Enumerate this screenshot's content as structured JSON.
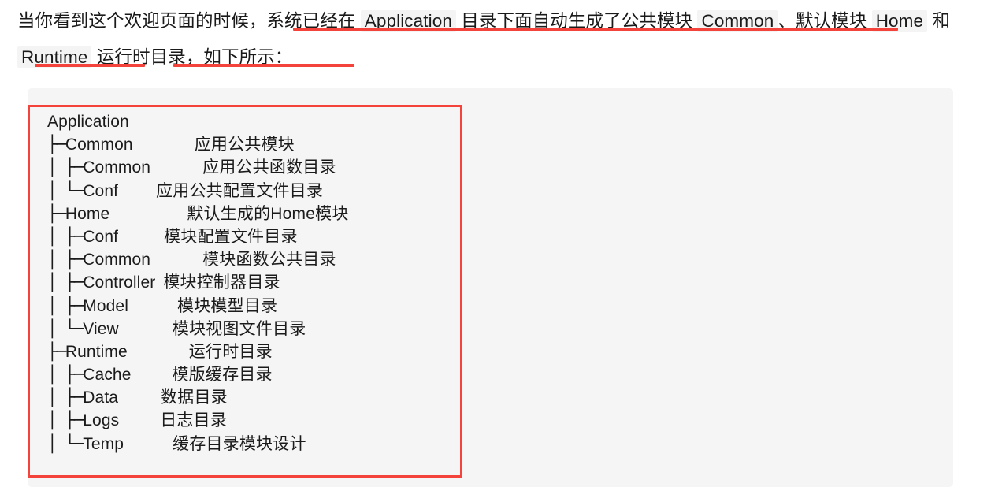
{
  "paragraph": {
    "segments": [
      {
        "type": "text",
        "value": "当你看到这个欢迎页面的时候，"
      },
      {
        "type": "text",
        "value": "系统已经在 "
      },
      {
        "type": "code",
        "value": "Application"
      },
      {
        "type": "text",
        "value": " 目录下面自动生成了公共模块 "
      },
      {
        "type": "code",
        "value": "Common"
      },
      {
        "type": "text",
        "value": "、默认模块 "
      },
      {
        "type": "code",
        "value": "Home"
      },
      {
        "type": "text",
        "value": " 和 "
      },
      {
        "type": "code",
        "value": "Runtime"
      },
      {
        "type": "text",
        "value": " 运行时目录，如下所示："
      }
    ],
    "line1": "当你看到这个欢迎页面的时候，系统已经在 Application 目录下面自动生成了公共模块 Common 、默认",
    "line2": "模块 Home 和 Runtime 运行时目录，如下所示：",
    "marker_color": "#f4433a",
    "code_background": "#f4f4f4",
    "text_color": "#1a1a1a"
  },
  "code_panel": {
    "background": "#f5f5f5",
    "highlight_border_color": "#f4433a"
  },
  "tree": {
    "rows": [
      {
        "branch": "",
        "gap1": 0,
        "name": "Application",
        "gap2": 0,
        "desc": ""
      },
      {
        "branch": "├─",
        "gap1": 0,
        "name": "Common",
        "gap2": 78,
        "desc": "应用公共模块"
      },
      {
        "branch": "│  ├─",
        "gap1": 0,
        "name": "Common",
        "gap2": 66,
        "desc": "应用公共函数目录"
      },
      {
        "branch": "│  └─",
        "gap1": 0,
        "name": "Conf",
        "gap2": 48,
        "desc": "应用公共配置文件目录"
      },
      {
        "branch": "├─",
        "gap1": 0,
        "name": "Home",
        "gap2": 98,
        "desc": "默认生成的Home模块"
      },
      {
        "branch": "│  ├─",
        "gap1": 0,
        "name": "Conf",
        "gap2": 58,
        "desc": "模块配置文件目录"
      },
      {
        "branch": "│  ├─",
        "gap1": 0,
        "name": "Common",
        "gap2": 66,
        "desc": "模块函数公共目录"
      },
      {
        "branch": "│  ├─",
        "gap1": 0,
        "name": "Controller",
        "gap2": 10,
        "desc": "模块控制器目录"
      },
      {
        "branch": "│  ├─",
        "gap1": 0,
        "name": "Model",
        "gap2": 62,
        "desc": "模块模型目录"
      },
      {
        "branch": "│  └─",
        "gap1": 0,
        "name": "View",
        "gap2": 68,
        "desc": "模块视图文件目录"
      },
      {
        "branch": "├─",
        "gap1": 0,
        "name": "Runtime",
        "gap2": 78,
        "desc": "运行时目录"
      },
      {
        "branch": "│  ├─",
        "gap1": 0,
        "name": "Cache",
        "gap2": 52,
        "desc": "模版缓存目录"
      },
      {
        "branch": "│  ├─",
        "gap1": 0,
        "name": "Data",
        "gap2": 54,
        "desc": "数据目录"
      },
      {
        "branch": "│  ├─",
        "gap1": 0,
        "name": "Logs",
        "gap2": 52,
        "desc": "日志目录"
      },
      {
        "branch": "│  └─",
        "gap1": 0,
        "name": "Temp",
        "gap2": 62,
        "desc": "缓存目录模块设计"
      }
    ],
    "text_color": "#1b1b1b"
  }
}
